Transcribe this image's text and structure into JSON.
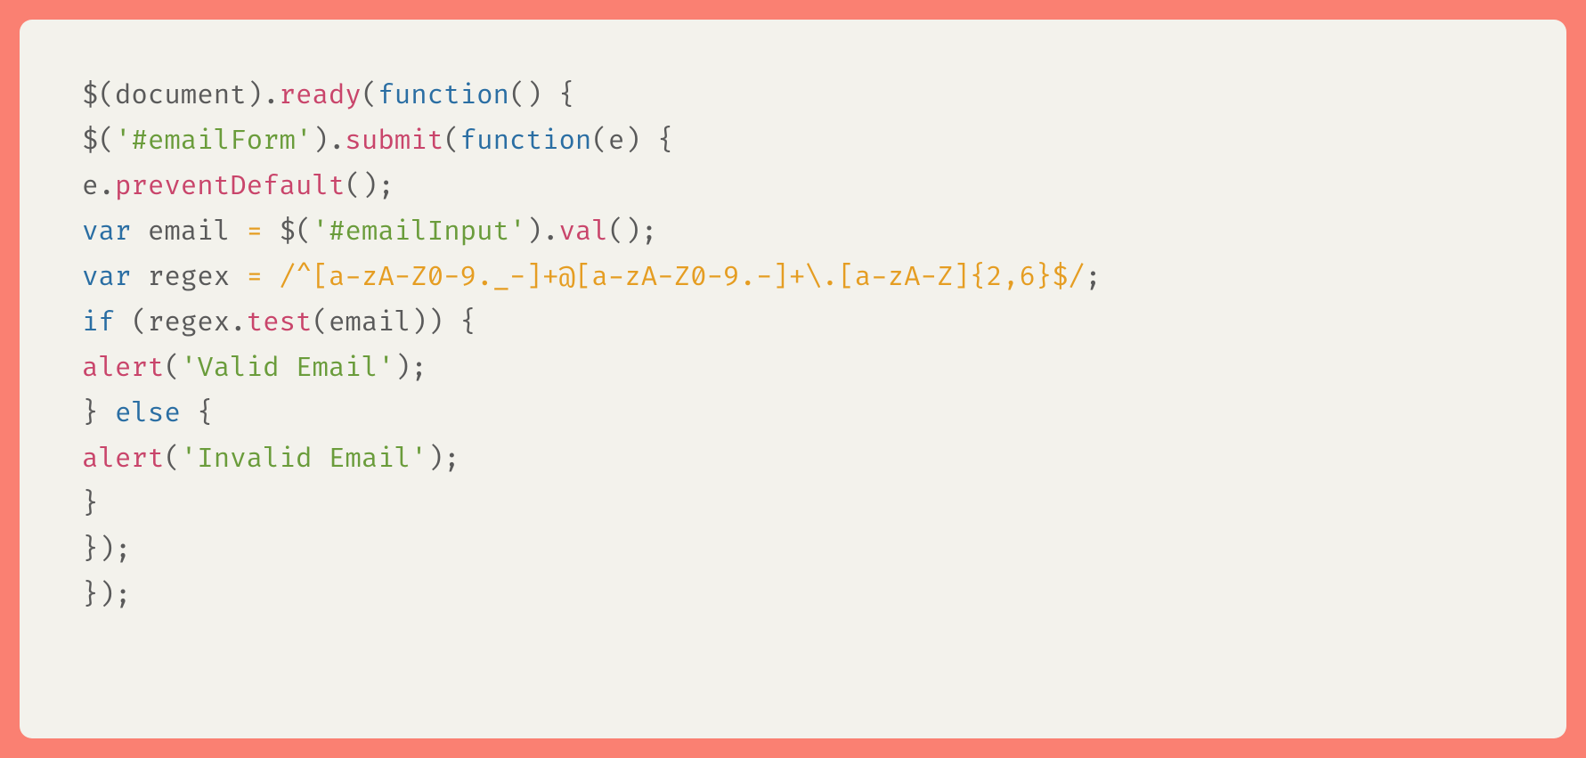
{
  "code": {
    "lines": [
      {
        "tokens": [
          {
            "t": "$",
            "c": "tok-default"
          },
          {
            "t": "(document).",
            "c": "tok-paren"
          },
          {
            "t": "ready",
            "c": "tok-call"
          },
          {
            "t": "(",
            "c": "tok-paren"
          },
          {
            "t": "function",
            "c": "tok-kw"
          },
          {
            "t": "() {",
            "c": "tok-paren"
          }
        ]
      },
      {
        "tokens": [
          {
            "t": "$",
            "c": "tok-default"
          },
          {
            "t": "(",
            "c": "tok-paren"
          },
          {
            "t": "'#emailForm'",
            "c": "tok-str"
          },
          {
            "t": ").",
            "c": "tok-paren"
          },
          {
            "t": "submit",
            "c": "tok-call"
          },
          {
            "t": "(",
            "c": "tok-paren"
          },
          {
            "t": "function",
            "c": "tok-kw"
          },
          {
            "t": "(e) {",
            "c": "tok-paren"
          }
        ]
      },
      {
        "tokens": [
          {
            "t": "e.",
            "c": "tok-paren"
          },
          {
            "t": "preventDefault",
            "c": "tok-call"
          },
          {
            "t": "();",
            "c": "tok-paren"
          }
        ]
      },
      {
        "tokens": [
          {
            "t": "var",
            "c": "tok-kw"
          },
          {
            "t": " email ",
            "c": "tok-default"
          },
          {
            "t": "=",
            "c": "tok-regex"
          },
          {
            "t": " ",
            "c": "tok-default"
          },
          {
            "t": "$",
            "c": "tok-default"
          },
          {
            "t": "(",
            "c": "tok-paren"
          },
          {
            "t": "'#emailInput'",
            "c": "tok-str"
          },
          {
            "t": ").",
            "c": "tok-paren"
          },
          {
            "t": "val",
            "c": "tok-call"
          },
          {
            "t": "();",
            "c": "tok-paren"
          }
        ]
      },
      {
        "tokens": [
          {
            "t": "var",
            "c": "tok-kw"
          },
          {
            "t": " regex ",
            "c": "tok-default"
          },
          {
            "t": "=",
            "c": "tok-regex"
          },
          {
            "t": " ",
            "c": "tok-default"
          },
          {
            "t": "/^[a-zA-Z0-9._-]+@[a-zA-Z0-9.-]+\\.[a-zA-Z]{2,6}$/",
            "c": "tok-regex"
          },
          {
            "t": ";",
            "c": "tok-paren"
          }
        ]
      },
      {
        "tokens": [
          {
            "t": "if",
            "c": "tok-kw"
          },
          {
            "t": " (regex.",
            "c": "tok-paren"
          },
          {
            "t": "test",
            "c": "tok-call"
          },
          {
            "t": "(email)) {",
            "c": "tok-paren"
          }
        ]
      },
      {
        "tokens": [
          {
            "t": "alert",
            "c": "tok-call"
          },
          {
            "t": "(",
            "c": "tok-paren"
          },
          {
            "t": "'Valid Email'",
            "c": "tok-str"
          },
          {
            "t": ");",
            "c": "tok-paren"
          }
        ]
      },
      {
        "tokens": [
          {
            "t": "} ",
            "c": "tok-paren"
          },
          {
            "t": "else",
            "c": "tok-kw"
          },
          {
            "t": " {",
            "c": "tok-paren"
          }
        ]
      },
      {
        "tokens": [
          {
            "t": "alert",
            "c": "tok-call"
          },
          {
            "t": "(",
            "c": "tok-paren"
          },
          {
            "t": "'Invalid Email'",
            "c": "tok-str"
          },
          {
            "t": ");",
            "c": "tok-paren"
          }
        ]
      },
      {
        "tokens": [
          {
            "t": "}",
            "c": "tok-paren"
          }
        ]
      },
      {
        "tokens": [
          {
            "t": "});",
            "c": "tok-paren"
          }
        ]
      },
      {
        "tokens": [
          {
            "t": "});",
            "c": "tok-paren"
          }
        ]
      }
    ]
  }
}
